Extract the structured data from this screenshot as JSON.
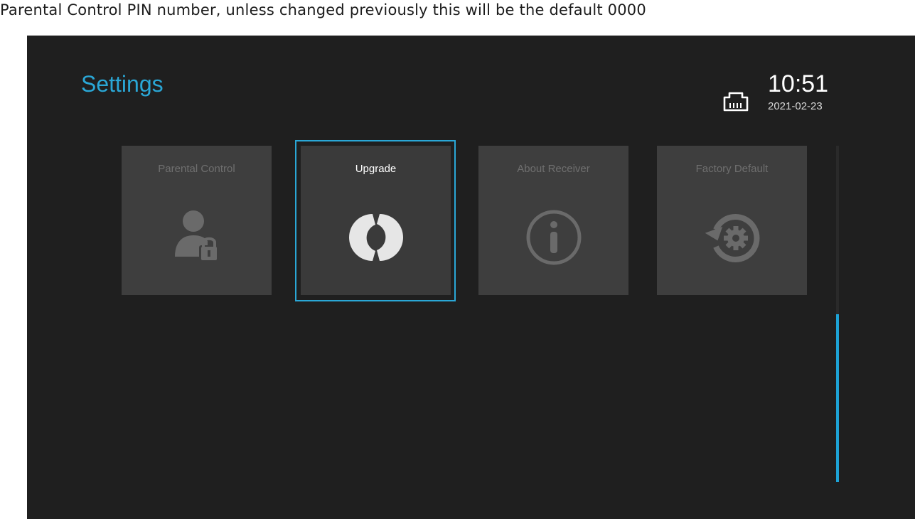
{
  "caption": "Parental Control PIN number, unless changed previously this will be the default 0000",
  "header": {
    "title": "Settings",
    "network_icon": "ethernet-port-icon",
    "time": "10:51",
    "date": "2021-02-23"
  },
  "tiles": [
    {
      "label": "Parental Control",
      "icon": "user-lock-icon",
      "selected": false
    },
    {
      "label": "Upgrade",
      "icon": "refresh-icon",
      "selected": true
    },
    {
      "label": "About Receiver",
      "icon": "info-icon",
      "selected": false
    },
    {
      "label": "Factory Default",
      "icon": "restore-settings-icon",
      "selected": false
    }
  ],
  "scrollbar": {
    "position_fraction": 0.5,
    "visible_fraction": 0.5
  },
  "colors": {
    "accent": "#2aa7d6",
    "background": "#1f1f1f",
    "tile": "#3e3e3e",
    "muted_text": "#6f6f6f"
  }
}
